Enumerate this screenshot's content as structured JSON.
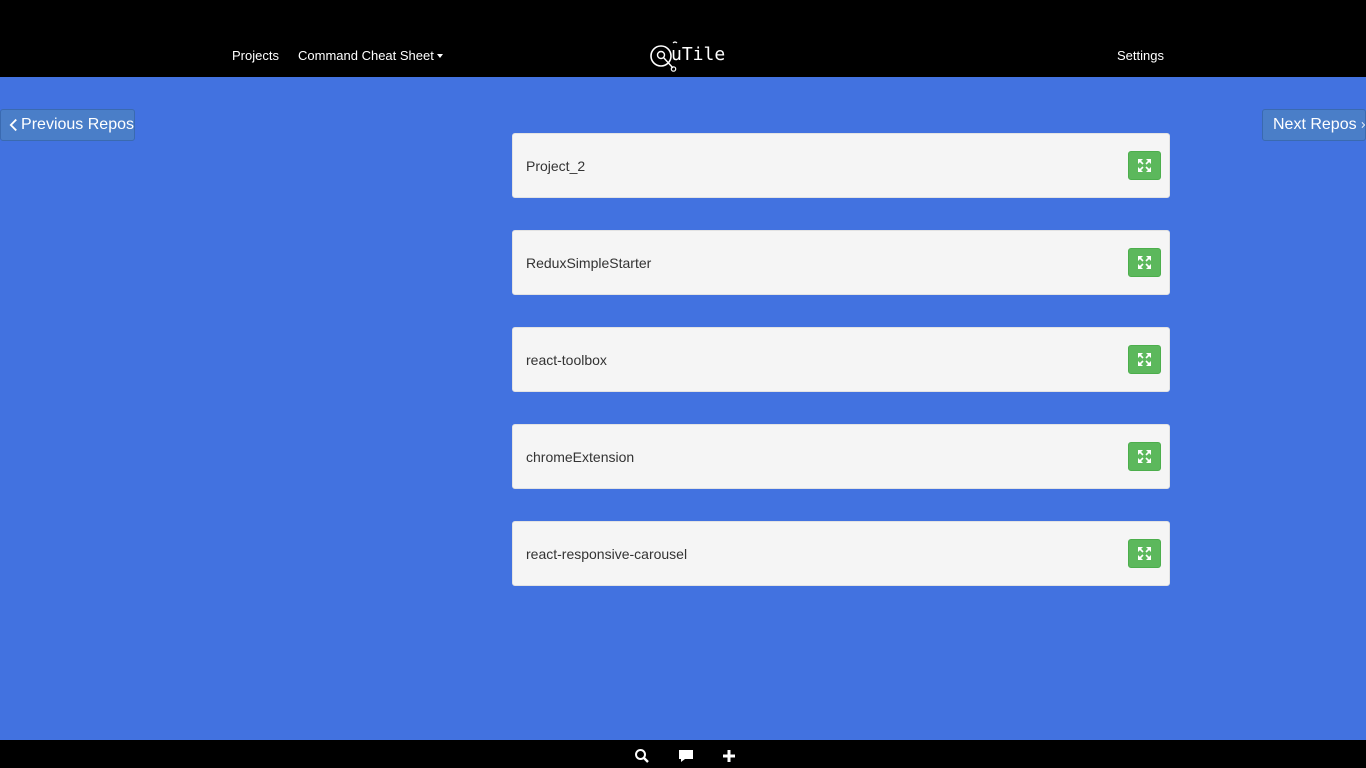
{
  "nav": {
    "projects_label": "Projects",
    "cheat_sheet_label": "Command Cheat Sheet",
    "settings_label": "Settings",
    "brand_text": "uTile"
  },
  "pager": {
    "previous_label": "Previous Repos",
    "next_label": "Next Repos"
  },
  "repos": [
    {
      "name": "Project_2"
    },
    {
      "name": "ReduxSimpleStarter"
    },
    {
      "name": "react-toolbox"
    },
    {
      "name": "chromeExtension"
    },
    {
      "name": "react-responsive-carousel"
    }
  ],
  "icons": {
    "expand": "expand-icon",
    "search": "search-icon",
    "chat": "chat-icon",
    "add": "plus-icon",
    "chevron_left": "chevron-left-icon",
    "chevron_right": "chevron-right-icon"
  },
  "colors": {
    "background": "#4272e0",
    "navbar": "#000000",
    "expand_button": "#5cb85c",
    "card": "#f5f5f5"
  }
}
